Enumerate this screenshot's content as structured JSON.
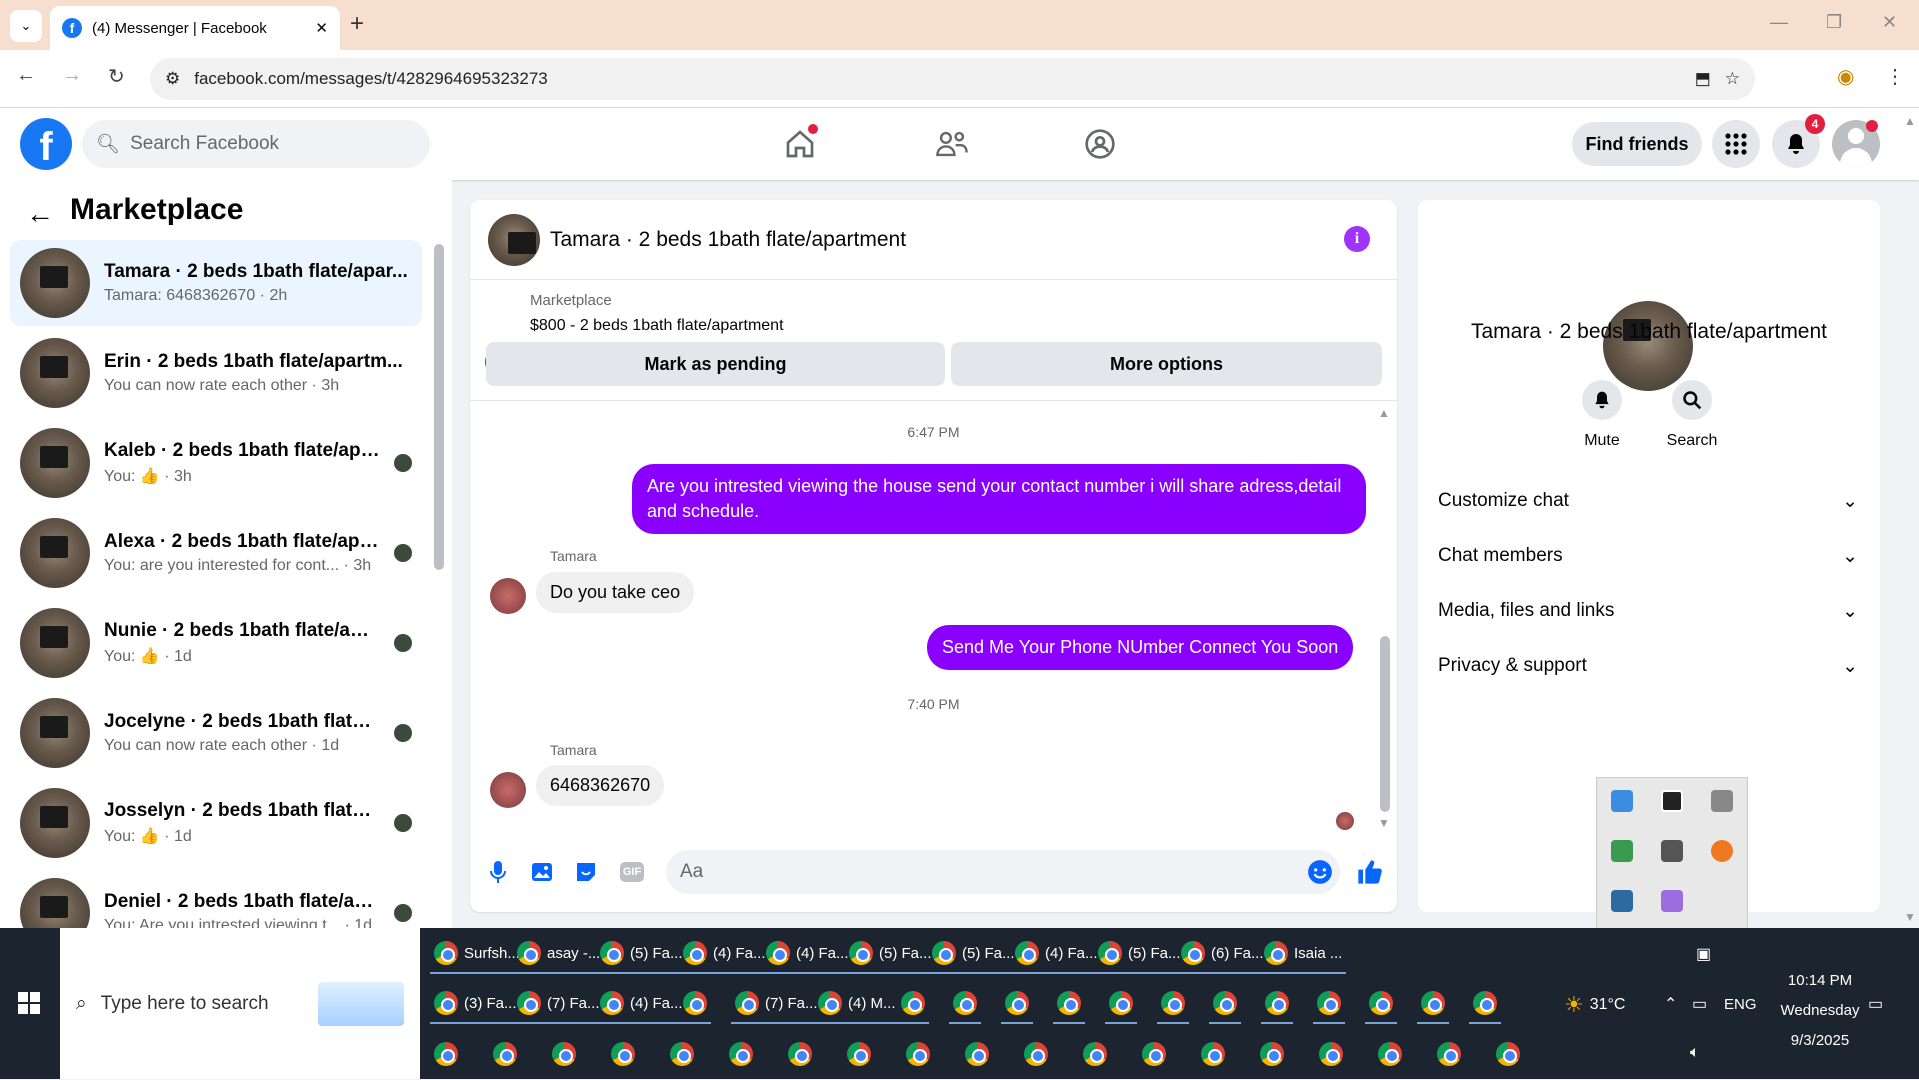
{
  "browser": {
    "tab_title": "(4) Messenger | Facebook",
    "url": "facebook.com/messages/t/4282964695323273"
  },
  "fb": {
    "search_placeholder": "Search Facebook",
    "find_friends": "Find friends",
    "notif_count": "4"
  },
  "sidebar": {
    "title": "Marketplace",
    "conversations": [
      {
        "title": "Tamara · 2 beds 1bath flate/apar...",
        "sub": "Tamara: 6468362670 · 2h",
        "active": true
      },
      {
        "title": "Erin · 2 beds 1bath flate/apartm...",
        "sub": "You can now rate each other · 3h"
      },
      {
        "title": "Kaleb · 2 beds 1bath flate/apa...",
        "sub": "You: 👍 · 3h"
      },
      {
        "title": "Alexa · 2 beds 1bath flate/apa...",
        "sub": "You: are you interested for cont... · 3h"
      },
      {
        "title": "Nunie · 2 beds 1bath flate/apa...",
        "sub": "You: 👍 · 1d"
      },
      {
        "title": "Jocelyne · 2 beds 1bath flate/ap...",
        "sub": "You can now rate each other · 1d"
      },
      {
        "title": "Josselyn · 2 beds 1bath flate/a...",
        "sub": "You: 👍 · 1d"
      },
      {
        "title": "Deniel · 2 beds 1bath flate/ap...",
        "sub": "You: Are you intrested viewing t... · 1d"
      }
    ]
  },
  "chat": {
    "title": "Tamara · 2 beds 1bath flate/apartment",
    "marketplace_label": "Marketplace",
    "listing": "$800 - 2 beds 1bath flate/apartment",
    "mark_pending": "Mark as pending",
    "more_options": "More options",
    "time1": "6:47 PM",
    "msg_out1": "Are you intrested viewing the house send your contact number i will share adress,detail and schedule.",
    "sender1": "Tamara",
    "msg_in1": "Do you take ceo",
    "msg_out2": "Send Me Your Phone NUmber  Connect You Soon",
    "time2": "7:40 PM",
    "sender2": "Tamara",
    "msg_in2": "6468362670",
    "input_placeholder": "Aa"
  },
  "details": {
    "title": "Tamara · 2 beds 1bath flate/apartment",
    "mute": "Mute",
    "search": "Search",
    "sections": [
      "Customize chat",
      "Chat members",
      "Media, files and links",
      "Privacy & support"
    ]
  },
  "taskbar": {
    "search_placeholder": "Type here to search",
    "row1": [
      "Surfsh...",
      "asay -...",
      "(5) Fa...",
      "(4) Fa...",
      "(4) Fa...",
      "(5) Fa...",
      "(5) Fa...",
      "(4) Fa...",
      "(5) Fa...",
      "(6) Fa...",
      "Isaia ..."
    ],
    "row2": [
      "(3) Fa...",
      "(7) Fa...",
      "(4) Fa...",
      "",
      "(7) Fa...",
      "(4) M..."
    ],
    "weather": "31°C",
    "lang": "ENG",
    "time": "10:14 PM",
    "day": "Wednesday",
    "date": "9/3/2025"
  }
}
